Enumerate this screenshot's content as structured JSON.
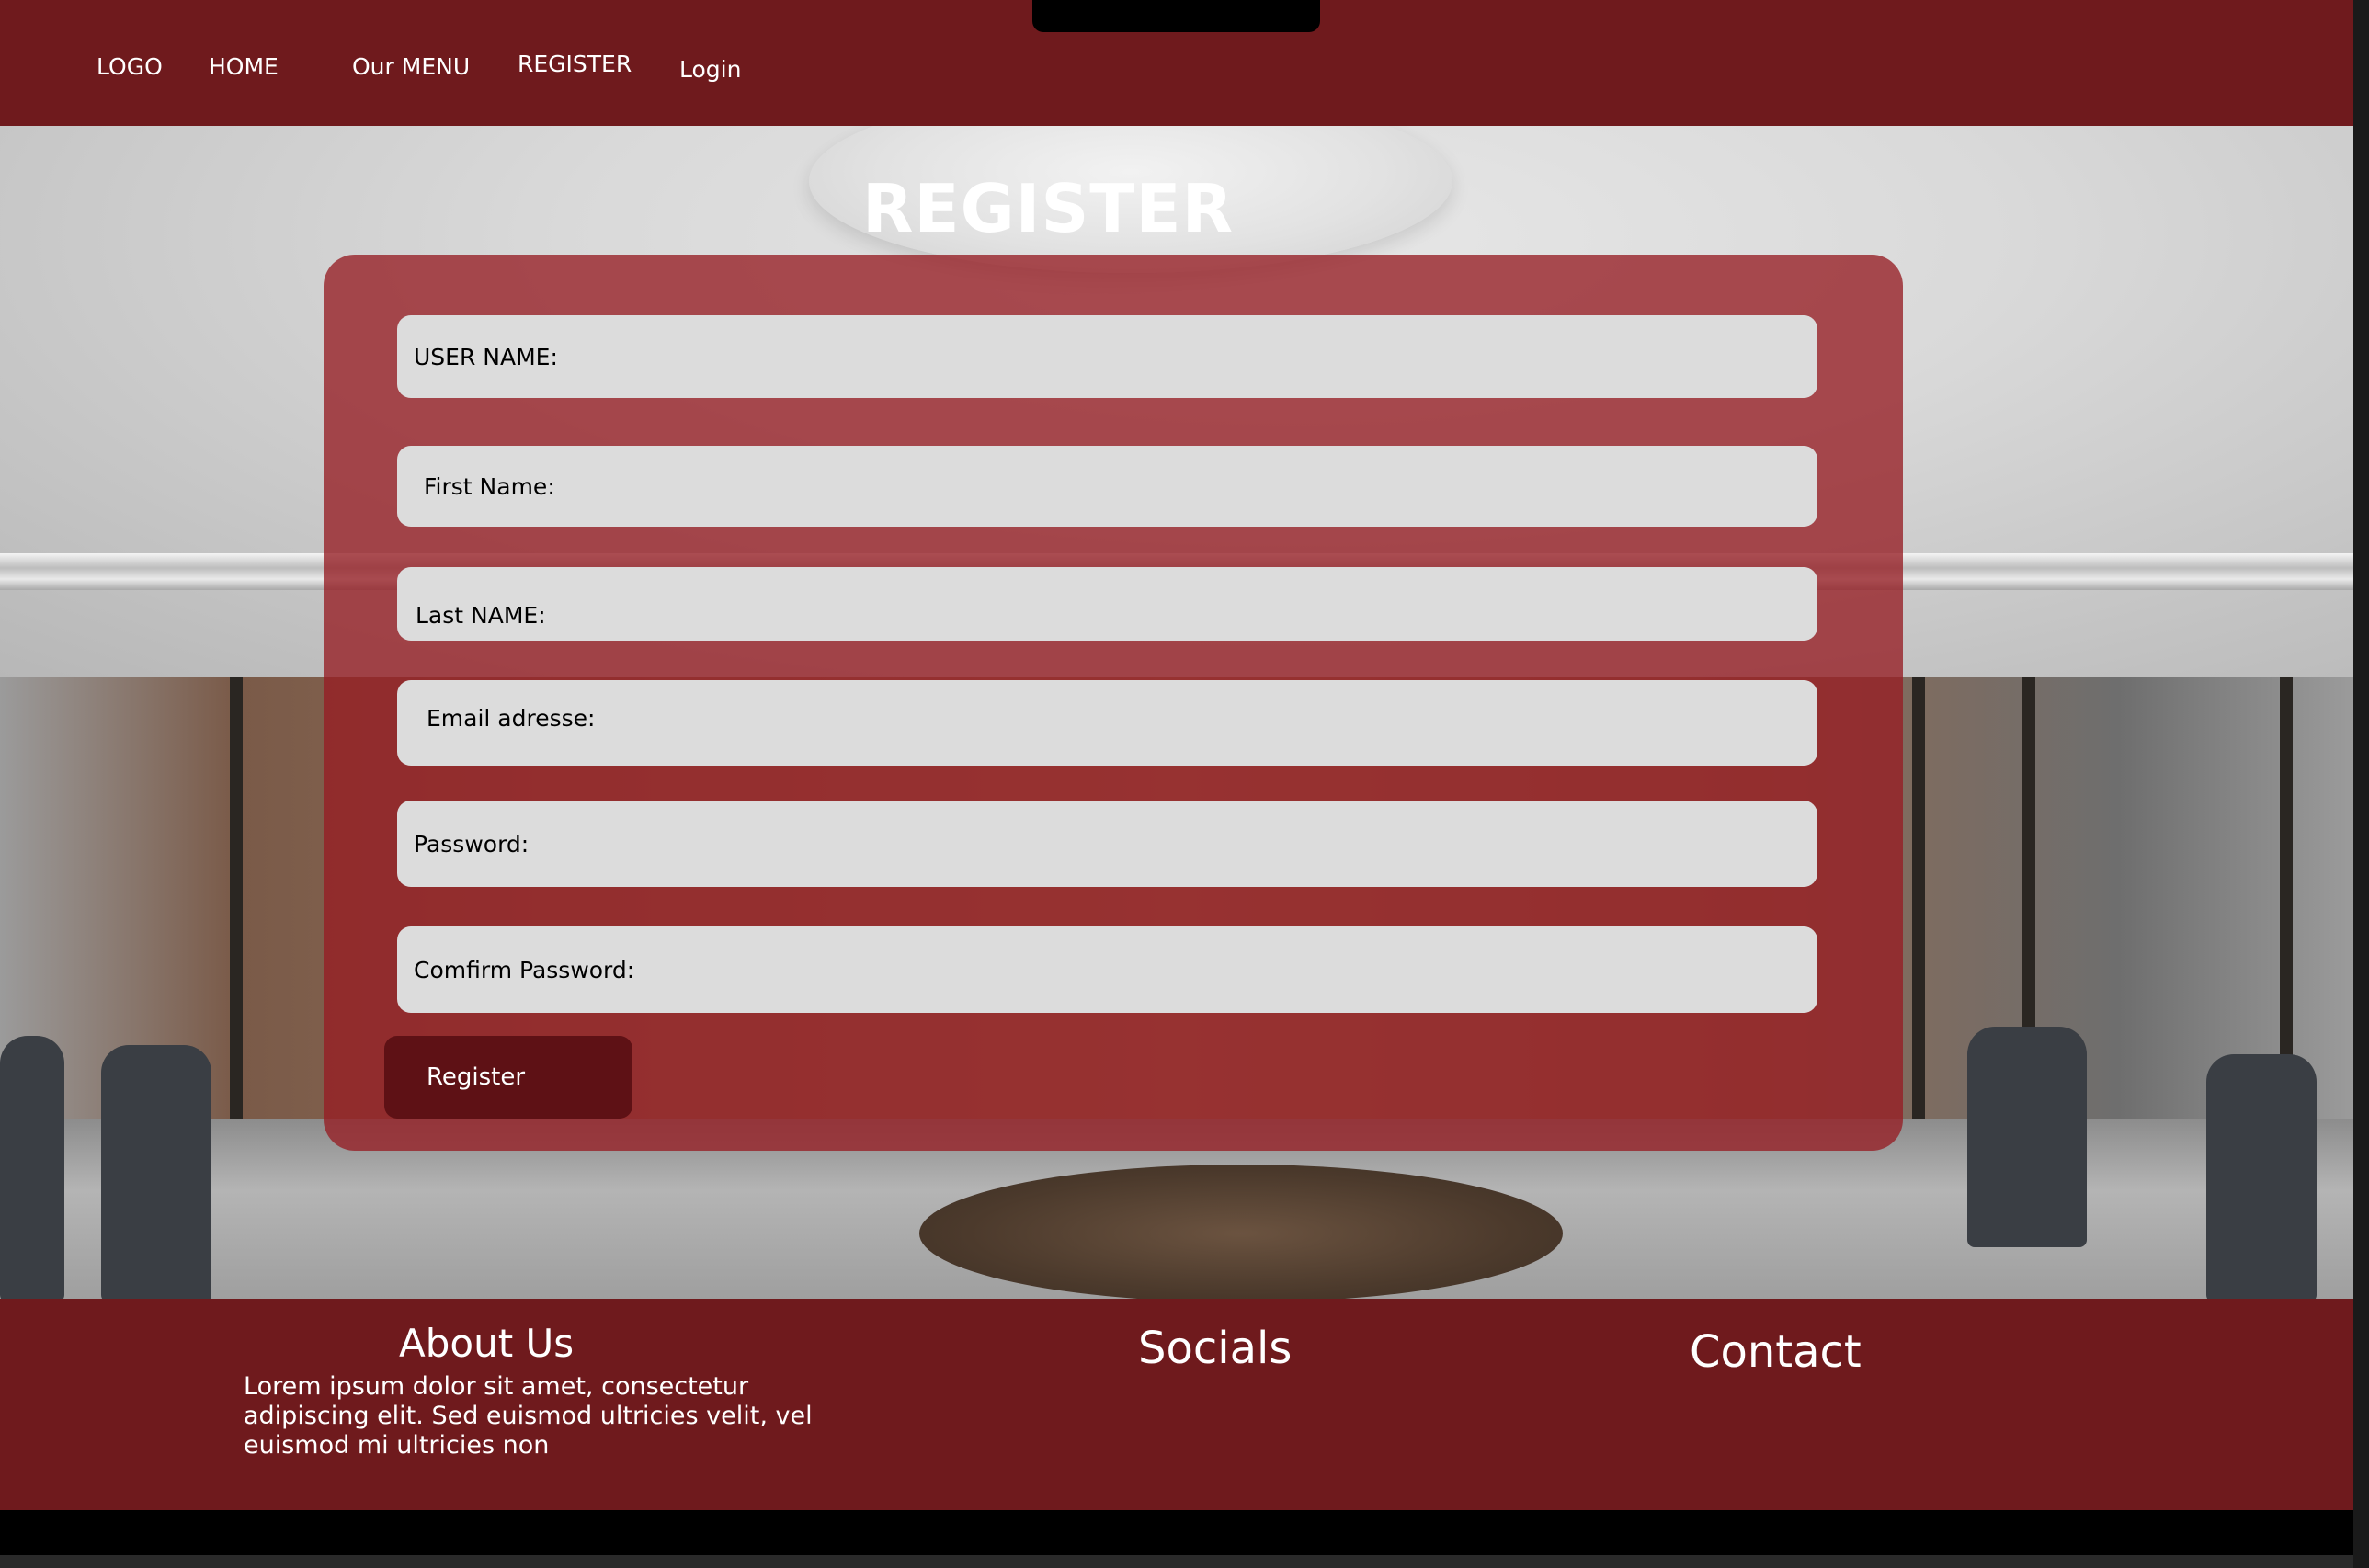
{
  "nav": {
    "logo": "LOGO",
    "home": "HOME",
    "menu": "Our MENU",
    "register": "REGISTER",
    "login": "Login"
  },
  "page": {
    "title": "REGISTER"
  },
  "form": {
    "username_label": "USER NAME:",
    "first_name_label": "First Name:",
    "last_name_label": "Last NAME:",
    "email_label": "Email adresse:",
    "password_label": "Password:",
    "confirm_password_label": "Comfirm Password:",
    "submit_label": "Register"
  },
  "footer": {
    "about_title": "About Us",
    "about_text": "Lorem ipsum dolor sit amet, consectetur adipiscing elit. Sed euismod ultricies velit, vel euismod mi ultricies non",
    "socials_title": "Socials",
    "contact_title": "Contact"
  },
  "colors": {
    "brand": "#6f1a1d",
    "panel": "#961e24",
    "field": "#dcdcdc",
    "button": "#5e1115"
  }
}
